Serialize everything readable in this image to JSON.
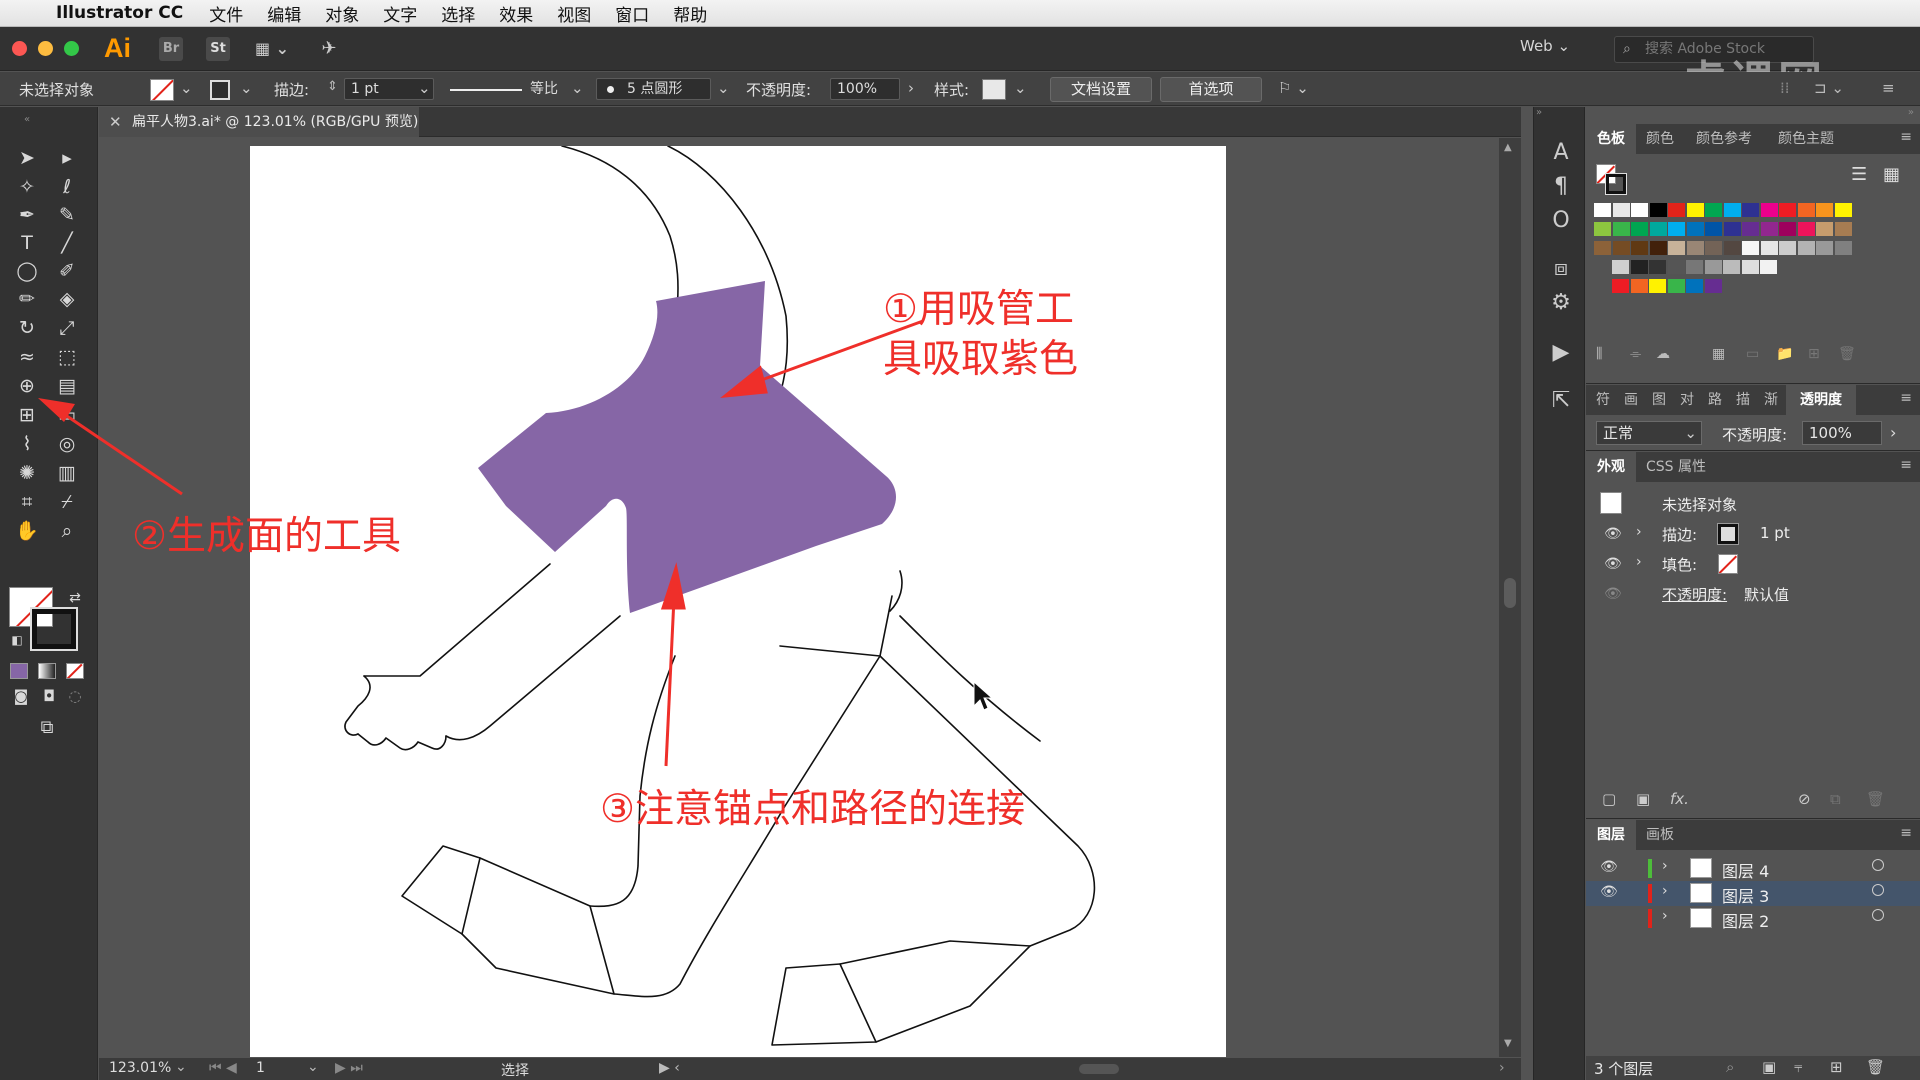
{
  "menubar": {
    "app_name": "Illustrator CC",
    "items": [
      "文件",
      "编辑",
      "对象",
      "文字",
      "选择",
      "效果",
      "视图",
      "窗口",
      "帮助"
    ]
  },
  "appbar": {
    "logo": "Ai",
    "br": "Br",
    "st": "St",
    "workspace": "Web",
    "search_placeholder": "搜索 Adobe Stock",
    "watermark": "虎课网"
  },
  "controlbar": {
    "selection_status": "未选择对象",
    "stroke_label": "描边:",
    "stroke_value": "1 pt",
    "profile_label": "等比",
    "brush_label": "5 点圆形",
    "opacity_label": "不透明度:",
    "opacity_value": "100%",
    "style_label": "样式:",
    "doc_setup": "文档设置",
    "preferences": "首选项"
  },
  "document": {
    "tab_title": "扁平人物3.ai* @ 123.01% (RGB/GPU 预览)",
    "zoom": "123.01%",
    "artboard_number": "1",
    "status_tool": "选择"
  },
  "colors": {
    "purple_fill": "#8666a6",
    "annotation": "#ef2f2a",
    "accent": "#ff9a00"
  },
  "annotations": {
    "a1_line1": "①用吸管工",
    "a1_line2": "具吸取紫色",
    "a2": "②生成面的工具",
    "a3": "③注意锚点和路径的连接"
  },
  "swatches_panel": {
    "tabs": [
      "色板",
      "颜色",
      "颜色参考",
      "颜色主题"
    ]
  },
  "transparency_panel": {
    "tabs": [
      "符",
      "画",
      "图",
      "对",
      "路",
      "描",
      "渐",
      "透明度"
    ],
    "blend_mode": "正常",
    "opacity_label": "不透明度:",
    "opacity_value": "100%"
  },
  "appearance_panel": {
    "tabs": [
      "外观",
      "CSS 属性"
    ],
    "title": "未选择对象",
    "stroke_label": "描边:",
    "stroke_value": "1 pt",
    "fill_label": "填色:",
    "opacity_label": "不透明度:",
    "opacity_value": "默认值"
  },
  "layers_panel": {
    "tabs": [
      "图层",
      "画板"
    ],
    "layers": [
      {
        "name": "图层 4",
        "color": "#4dbd3a"
      },
      {
        "name": "图层 3",
        "color": "#e2231a"
      },
      {
        "name": "图层 2",
        "color": "#e2231a"
      }
    ],
    "count": "3 个图层"
  }
}
